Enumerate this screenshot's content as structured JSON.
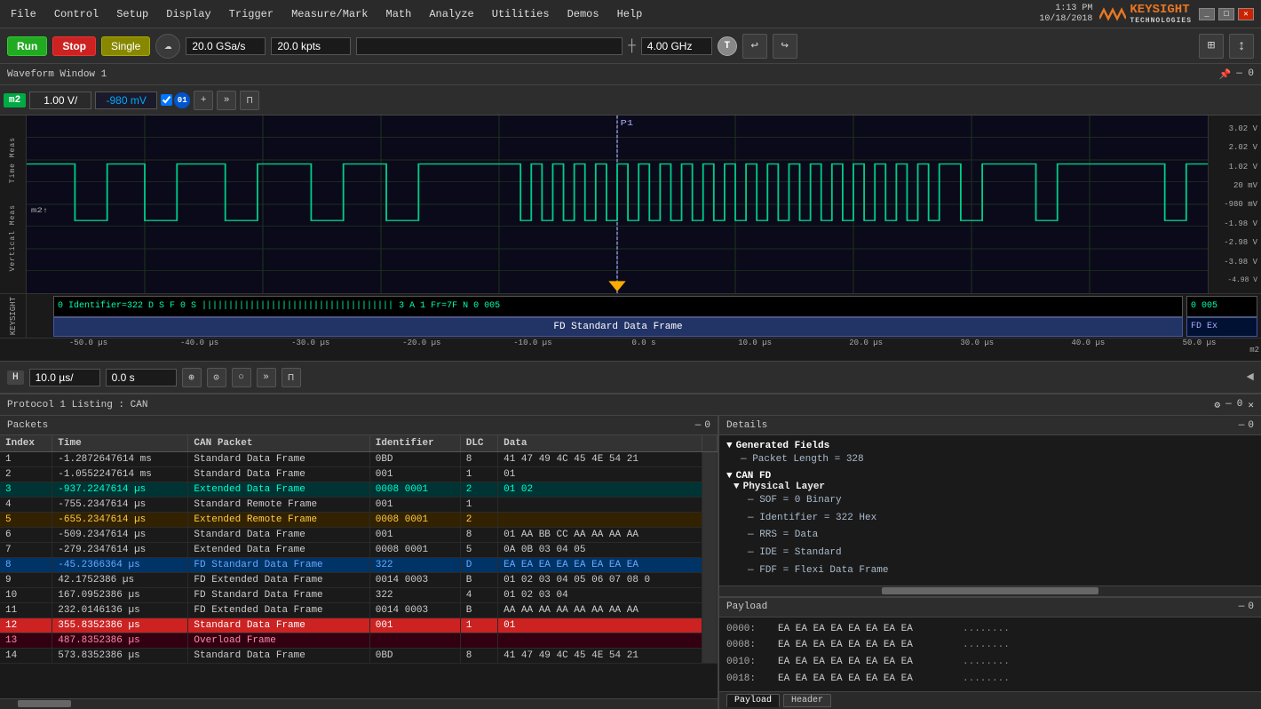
{
  "titlebar": {
    "datetime": "1:13 PM\n10/18/2018",
    "brand": "KEYSIGHT",
    "brand_sub": "TECHNOLOGIES"
  },
  "menu": {
    "items": [
      "File",
      "Control",
      "Setup",
      "Display",
      "Trigger",
      "Measure/Mark",
      "Math",
      "Analyze",
      "Utilities",
      "Demos",
      "Help"
    ]
  },
  "toolbar": {
    "run_label": "Run",
    "stop_label": "Stop",
    "single_label": "Single",
    "sample_rate": "20.0 GSa/s",
    "memory_depth": "20.0 kpts",
    "frequency": "4.00 GHz",
    "trigger_btn": "T"
  },
  "waveform": {
    "title": "Waveform Window 1",
    "channel": "m2",
    "volt_scale": "1.00 V/",
    "offset": "-980 mV",
    "y_labels": [
      "3.02 V",
      "2.02 V",
      "1.02 V",
      "20 mV",
      "-980 mV",
      "-1.98 V",
      "-2.98 V",
      "-3.98 V",
      "-4.98 V"
    ],
    "time_labels": [
      "-50.0 µs",
      "-40.0 µs",
      "-30.0 µs",
      "-20.0 µs",
      "-10.0 µs",
      "0.0 s",
      "10.0 µs",
      "20.0 µs",
      "30.0 µs",
      "40.0 µs",
      "50.0 µs"
    ],
    "decode_top": "0  Identifier=322  D  S  F  0  S  ||||||||||||||||||||||||||||||||||||  3  A  1      Fr=7F      N      0  005",
    "decode_bottom": "FD Standard Data Frame",
    "decode_right_top": "0  005",
    "decode_right_bottom": "FD Ex",
    "cursor_label": "P1",
    "time_scale": "10.0 µs/",
    "time_offset": "0.0 s"
  },
  "protocol": {
    "title": "Protocol 1 Listing : CAN",
    "packets_label": "Packets",
    "details_label": "Details",
    "columns": [
      "Index",
      "Time",
      "CAN Packet",
      "Identifier",
      "DLC",
      "Data"
    ],
    "rows": [
      {
        "index": "1",
        "time": "-1.2872647614 ms",
        "packet": "Standard Data Frame",
        "id": "0BD",
        "dlc": "8",
        "data": "41 47 49 4C 45 4E 54 21",
        "style": "default"
      },
      {
        "index": "2",
        "time": "-1.0552247614 ms",
        "packet": "Standard Data Frame",
        "id": "001",
        "dlc": "1",
        "data": "01",
        "style": "default"
      },
      {
        "index": "3",
        "time": "-937.2247614 µs",
        "packet": "Extended Data Frame",
        "id": "0008 0001",
        "dlc": "2",
        "data": "01 02",
        "style": "cyan"
      },
      {
        "index": "4",
        "time": "-755.2347614 µs",
        "packet": "Standard Remote Frame",
        "id": "001",
        "dlc": "1",
        "data": "",
        "style": "default"
      },
      {
        "index": "5",
        "time": "-655.2347614 µs",
        "packet": "Extended Remote Frame",
        "id": "0008 0001",
        "dlc": "2",
        "data": "",
        "style": "yellow"
      },
      {
        "index": "6",
        "time": "-509.2347614 µs",
        "packet": "Standard Data Frame",
        "id": "001",
        "dlc": "8",
        "data": "01 AA BB CC AA AA AA AA",
        "style": "default"
      },
      {
        "index": "7",
        "time": "-279.2347614 µs",
        "packet": "Extended Data Frame",
        "id": "0008 0001",
        "dlc": "5",
        "data": "0A 0B 03 04 05",
        "style": "default"
      },
      {
        "index": "8",
        "time": "-45.2366364 µs",
        "packet": "FD Standard Data Frame",
        "id": "322",
        "dlc": "D",
        "data": "EA EA EA EA EA EA EA EA",
        "style": "blue-selected"
      },
      {
        "index": "9",
        "time": "42.1752386 µs",
        "packet": "FD Extended Data Frame",
        "id": "0014 0003",
        "dlc": "B",
        "data": "01 02 03 04 05 06 07 08 0",
        "style": "default"
      },
      {
        "index": "10",
        "time": "167.0952386 µs",
        "packet": "FD Standard Data Frame",
        "id": "322",
        "dlc": "4",
        "data": "01 02 03 04",
        "style": "default"
      },
      {
        "index": "11",
        "time": "232.0146136 µs",
        "packet": "FD Extended Data Frame",
        "id": "0014 0003",
        "dlc": "B",
        "data": "AA AA AA AA AA AA AA AA",
        "style": "default"
      },
      {
        "index": "12",
        "time": "355.8352386 µs",
        "packet": "Standard Data Frame",
        "id": "001",
        "dlc": "1",
        "data": "01",
        "style": "highlight"
      },
      {
        "index": "13",
        "time": "487.8352386 µs",
        "packet": "Overload Frame",
        "id": "",
        "dlc": "",
        "data": "",
        "style": "pink"
      },
      {
        "index": "14",
        "time": "573.8352386 µs",
        "packet": "Standard Data Frame",
        "id": "0BD",
        "dlc": "8",
        "data": "41 47 49 4C 45 4E 54 21",
        "style": "default"
      }
    ]
  },
  "details": {
    "title": "Details",
    "generated_fields": {
      "header": "Generated Fields",
      "packet_length": "Packet Length = 328"
    },
    "can_fd": {
      "header": "CAN FD",
      "physical_layer": {
        "header": "Physical Layer",
        "sof": "SOF = 0 Binary",
        "identifier": "Identifier = 322 Hex",
        "rrs": "RRS = Data",
        "ide": "IDE = Standard",
        "fdf": "FDF = Flexi Data Frame"
      }
    }
  },
  "payload": {
    "title": "Payload",
    "rows": [
      {
        "addr": "0000:",
        "hex": "EA EA EA EA EA EA EA EA",
        "ascii": "........"
      },
      {
        "addr": "0008:",
        "hex": "EA EA EA EA EA EA EA EA",
        "ascii": "........"
      },
      {
        "addr": "0010:",
        "hex": "EA EA EA EA EA EA EA EA",
        "ascii": "........"
      },
      {
        "addr": "0018:",
        "hex": "EA EA EA EA EA EA EA EA",
        "ascii": "........"
      }
    ],
    "tab_payload": "Payload",
    "tab_header": "Header"
  }
}
